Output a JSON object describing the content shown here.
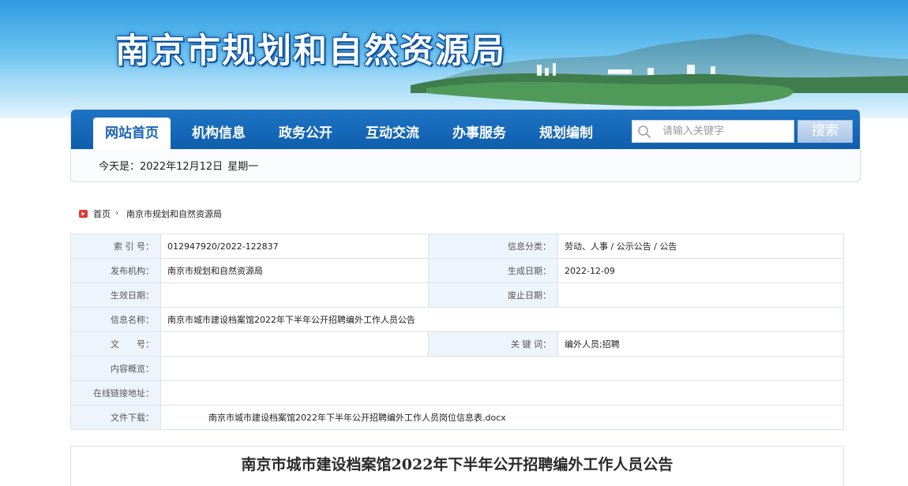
{
  "header": {
    "site_title": "南京市规划和自然资源局"
  },
  "nav": {
    "items": [
      {
        "label": "网站首页"
      },
      {
        "label": "机构信息"
      },
      {
        "label": "政务公开"
      },
      {
        "label": "互动交流"
      },
      {
        "label": "办事服务"
      },
      {
        "label": "规划编制"
      }
    ],
    "active_index": 0,
    "search_placeholder": "请输入关键字",
    "search_button": "搜索",
    "today_label": "今天是：",
    "today_date": "2022年12月12日",
    "today_weekday": "星期一"
  },
  "breadcrumb": {
    "home": "首页",
    "separator": "›",
    "current": "南京市规划和自然资源局"
  },
  "info": {
    "index_label": "索 引 号：",
    "index_value": "012947920/2022-122837",
    "category_label": "信息分类：",
    "category_value": "劳动、人事 / 公示公告 / 公告",
    "publisher_label": "发布机构：",
    "publisher_value": "南京市规划和自然资源局",
    "created_label": "生成日期：",
    "created_value": "2022-12-09",
    "effective_label": "生效日期：",
    "effective_value": "",
    "expired_label": "废止日期：",
    "expired_value": "",
    "name_label": "信息名称：",
    "name_value": "南京市城市建设档案馆2022年下半年公开招聘编外工作人员公告",
    "docno_label": "文　　号：",
    "docno_value": "",
    "keywords_label": "关 键 词：",
    "keywords_value": "编外人员;招聘",
    "summary_label": "内容概览：",
    "summary_value": "",
    "link_label": "在线链接地址：",
    "link_value": "",
    "download_label": "文件下载：",
    "download_value": "南京市城市建设档案馆2022年下半年公开招聘编外工作人员岗位信息表.docx"
  },
  "article": {
    "title": "南京市城市建设档案馆2022年下半年公开招聘编外工作人员公告"
  },
  "colors": {
    "nav_blue": "#1663b5",
    "label_bg": "#eef4fb",
    "active_tab_text": "#1d64b5"
  }
}
